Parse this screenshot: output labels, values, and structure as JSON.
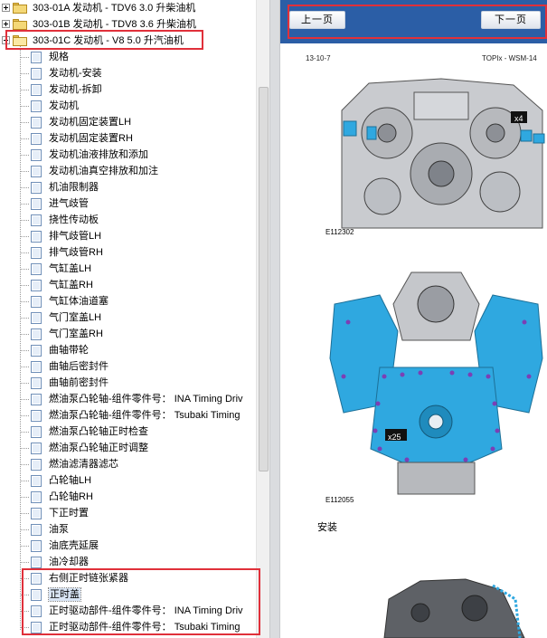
{
  "tree": {
    "folders": [
      {
        "label": "303-01A 发动机 - TDV6 3.0 升柴油机",
        "expanded": false
      },
      {
        "label": "303-01B 发动机 - TDV8 3.6 升柴油机",
        "expanded": false
      },
      {
        "label": "303-01C 发动机 - V8 5.0 升汽油机",
        "expanded": true
      }
    ],
    "items": [
      "规格",
      "发动机-安装",
      "发动机-拆卸",
      "发动机",
      "发动机固定装置LH",
      "发动机固定装置RH",
      "发动机油液排放和添加",
      "发动机油真空排放和加注",
      "机油限制器",
      "进气歧管",
      "挠性传动板",
      "排气歧管LH",
      "排气歧管RH",
      "气缸盖LH",
      "气缸盖RH",
      "气缸体油道塞",
      "气门室盖LH",
      "气门室盖RH",
      "曲轴带轮",
      "曲轴后密封件",
      "曲轴前密封件",
      "燃油泵凸轮轴-组件零件号： INA Timing Driv",
      "燃油泵凸轮轴-组件零件号： Tsubaki Timing",
      "燃油泵凸轮轴正时检查",
      "燃油泵凸轮轴正时调整",
      "燃油滤清器滤芯",
      "凸轮轴LH",
      "凸轮轴RH",
      "下正时置",
      "油泵",
      "油底壳延展",
      "油冷却器",
      "右侧正时链张紧器",
      "正时盖",
      "正时驱动部件-组件零件号： INA Timing Driv",
      "正时驱动部件-组件零件号： Tsubaki Timing"
    ],
    "selected_index": 33
  },
  "document": {
    "nav": {
      "prev_label": "上一页",
      "next_label": "下一页"
    },
    "header_date": "13-10-7",
    "header_code": "TOPIx - WSM-14",
    "figure1": {
      "code": "E112302",
      "callout": "x4"
    },
    "figure2": {
      "code": "E112055",
      "callout": "x25"
    },
    "section_title": "安装"
  },
  "colors": {
    "nav_bar": "#2b5ea6",
    "highlight_box": "#e0303a",
    "engine_cover_blue": "#2fa8e0",
    "bolt_purple": "#7b3fb5"
  }
}
